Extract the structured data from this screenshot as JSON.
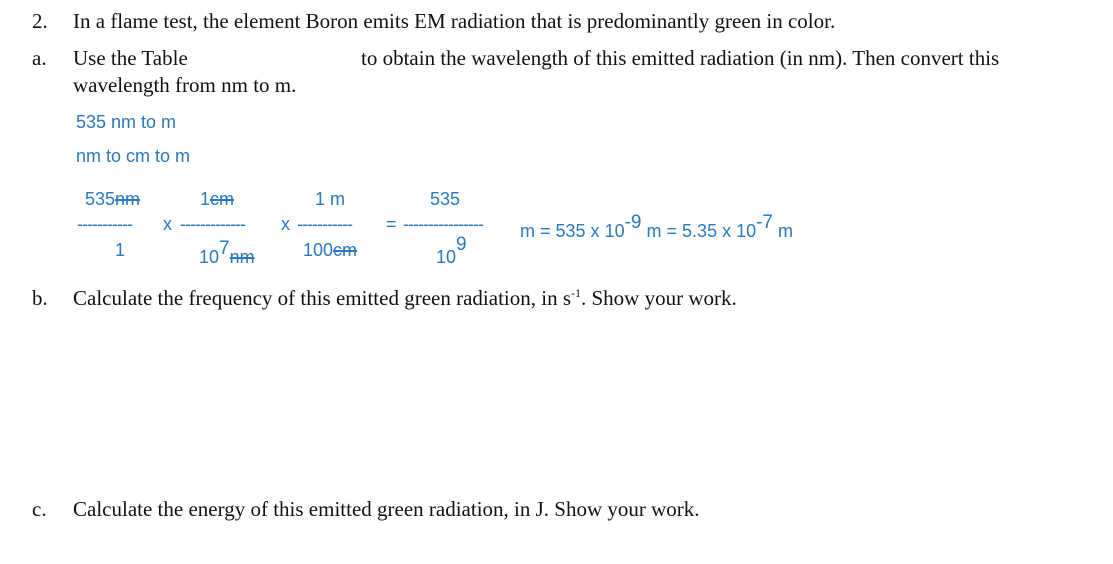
{
  "question": {
    "number": "2.",
    "text": "In a flame test, the element Boron emits EM radiation that is predominantly green in color."
  },
  "part_a": {
    "label": "a.",
    "text_before_gap": "Use the Table",
    "text_after_gap": "to obtain the wavelength of this emitted radiation (in nm).  Then convert this",
    "text_line2": "wavelength from nm to m.",
    "work": {
      "line1": "535 nm to m",
      "line2": "nm to cm to m",
      "fraction1": {
        "num_value": "535",
        "num_unit": "nm",
        "den": "1"
      },
      "op1": "x",
      "fraction2": {
        "num_value": "1",
        "num_unit": "cm",
        "den_base": "10",
        "den_exp": "7",
        "den_unit": "nm"
      },
      "op2": "x",
      "fraction3": {
        "num": "1 m",
        "den_value": "100",
        "den_unit": "cm"
      },
      "eq1": "=",
      "fraction4": {
        "num": "535",
        "den_base": "10",
        "den_exp": "9"
      },
      "result_unit": "m",
      "eq2": "= 535 x 10",
      "result2_exp": "-9",
      "result2_unit": "m",
      "eq3": "= 5.35 x 10",
      "result3_exp": "-7",
      "result3_unit": "m",
      "dash_short": "-----------",
      "dash_medium": "-------------",
      "dash_long": "----------------"
    }
  },
  "part_b": {
    "label": "b.",
    "text": "Calculate the frequency of this emitted green radiation, in s",
    "exp": "-1",
    "text_after": ".  Show your work."
  },
  "part_c": {
    "label": "c.",
    "text": "Calculate the energy of this emitted green radiation, in J.  Show your work."
  }
}
